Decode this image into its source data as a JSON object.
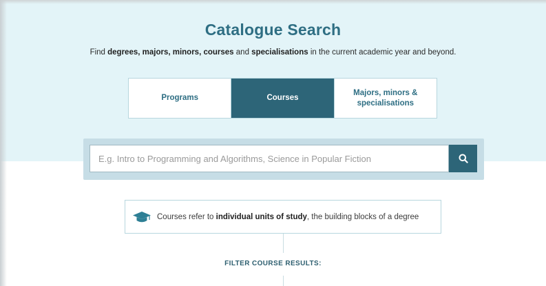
{
  "header": {
    "title": "Catalogue Search",
    "subtitle": {
      "prefix": "Find ",
      "b1": "degrees, majors, minors, courses",
      "mid1": " and ",
      "b2": "specialisations",
      "suffix": " in the current academic year and beyond."
    }
  },
  "tabs": [
    {
      "label": "Programs",
      "active": false
    },
    {
      "label": "Courses",
      "active": true
    },
    {
      "label": "Majors, minors & specialisations",
      "active": false
    }
  ],
  "search": {
    "placeholder": "E.g. Intro to Programming and Algorithms, Science in Popular Fiction",
    "value": "",
    "button_icon": "search-icon"
  },
  "info": {
    "icon": "graduation-cap-icon",
    "prefix": "Courses refer to ",
    "bold": "individual units of study",
    "suffix": ", the building blocks of a degree"
  },
  "filter": {
    "label": "FILTER COURSE RESULTS:"
  },
  "colors": {
    "hero_bg": "#e3f4f8",
    "title": "#2e6e83",
    "active_tab": "#2d6578",
    "search_frame": "#c6dde6"
  }
}
